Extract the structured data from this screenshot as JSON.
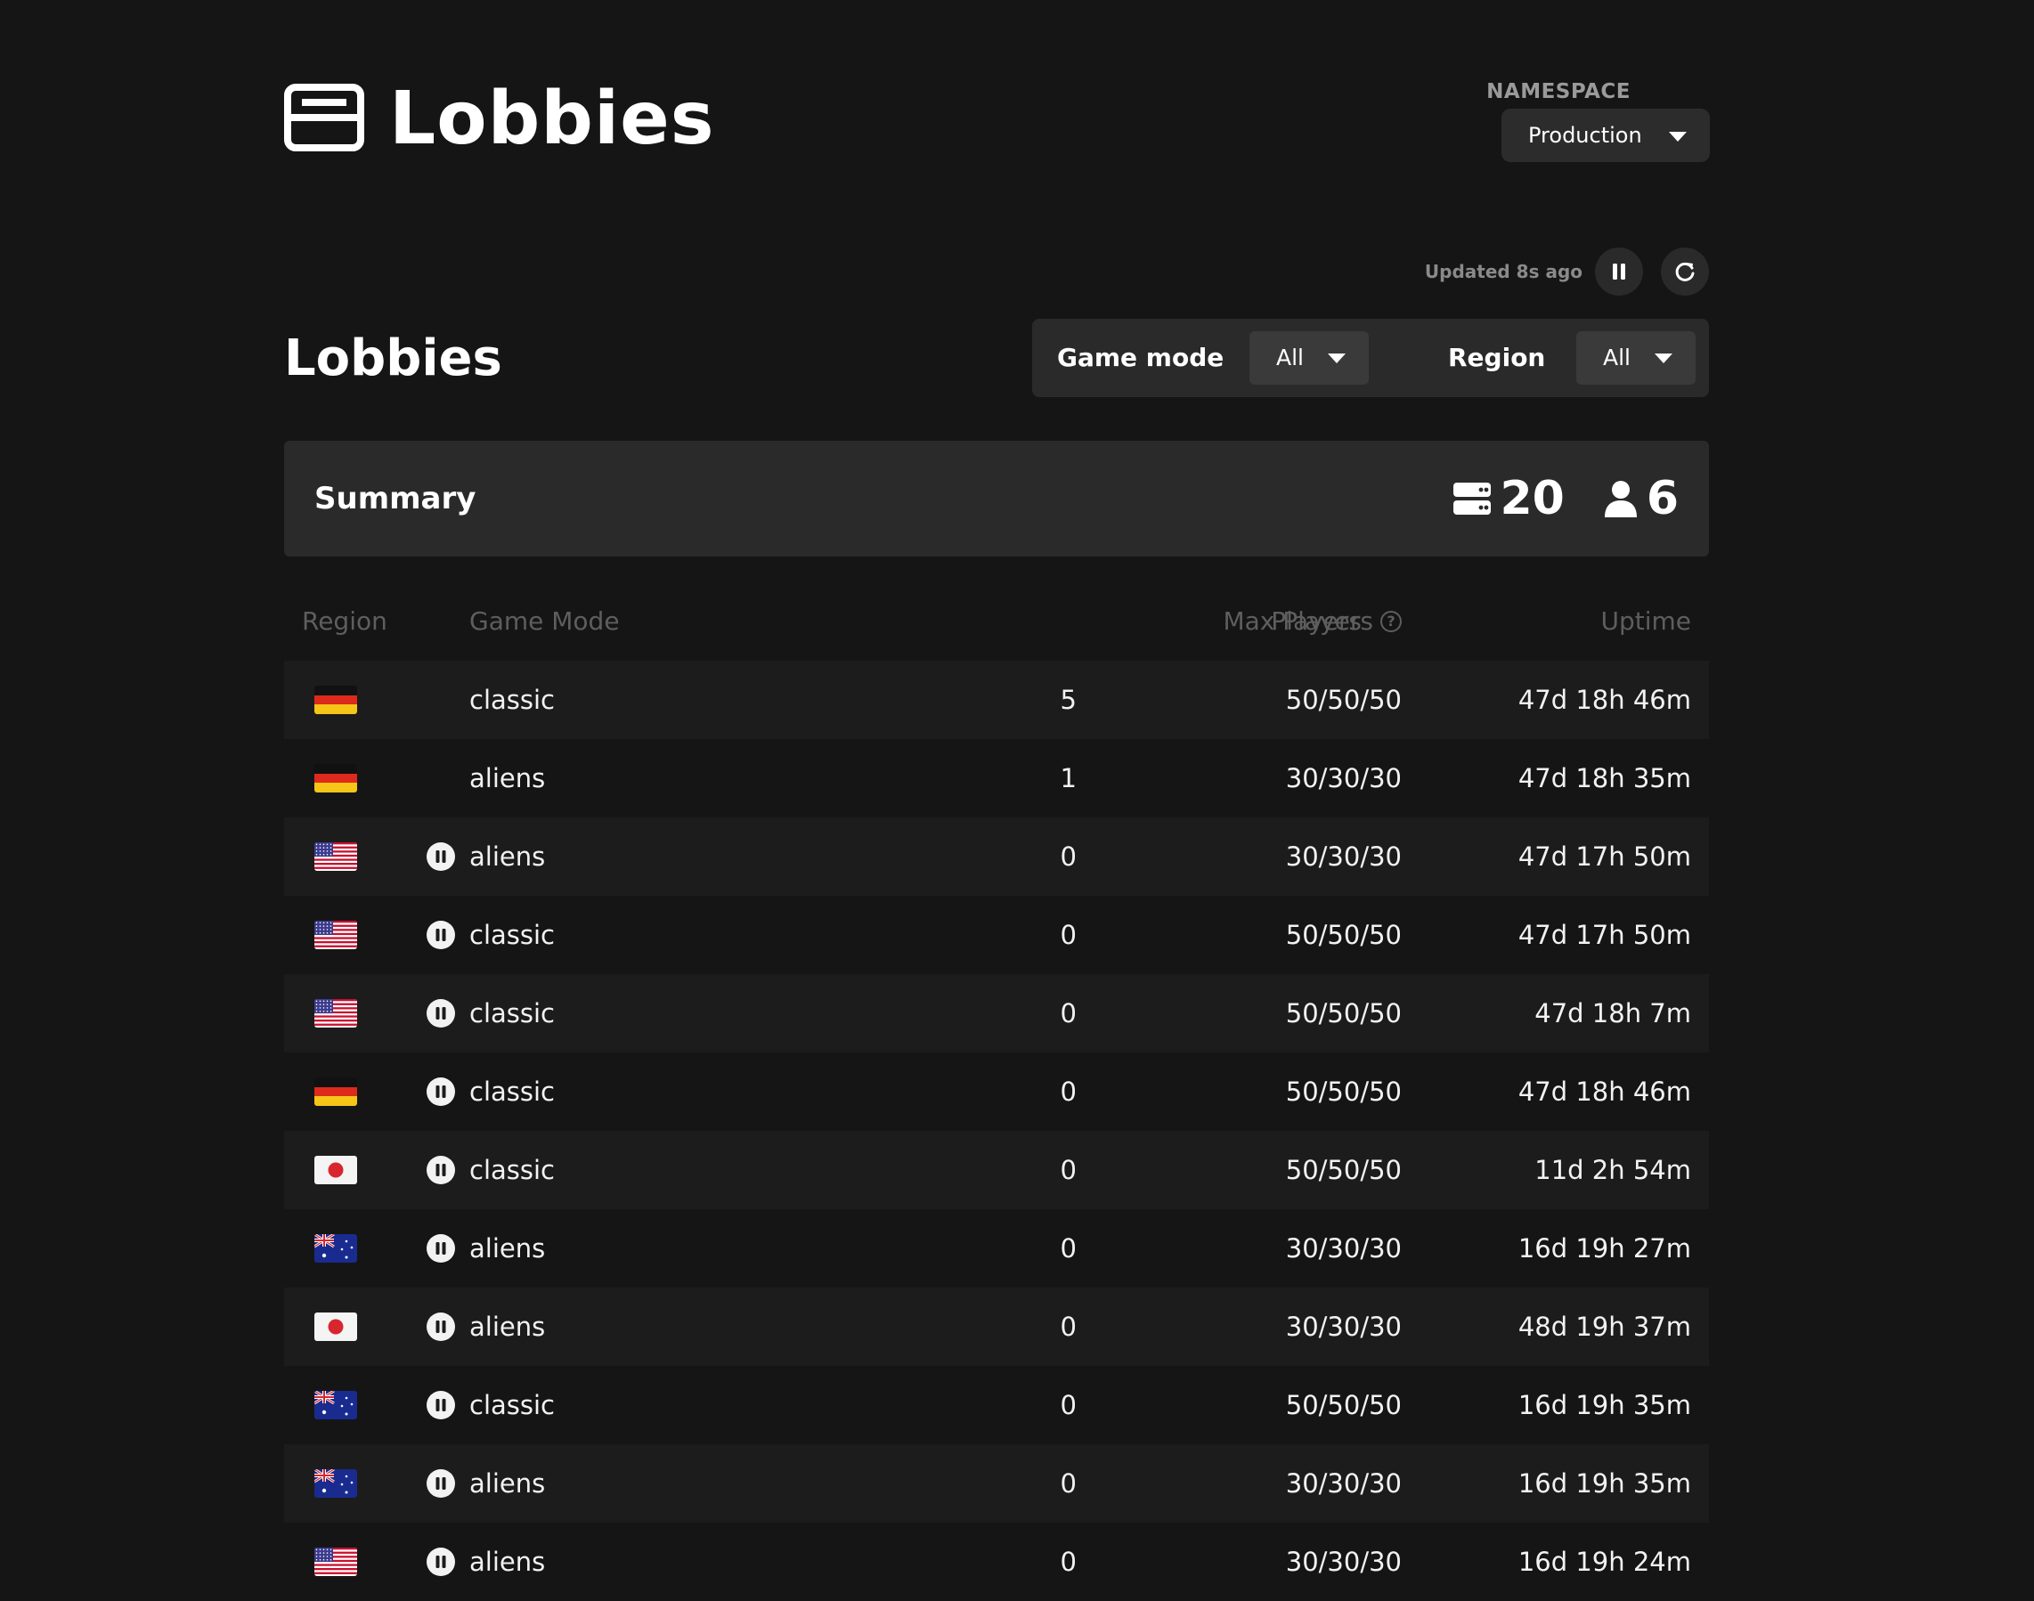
{
  "header": {
    "title": "Lobbies",
    "namespace_label": "NAMESPACE",
    "namespace_value": "Production"
  },
  "refresh": {
    "updated_text": "Updated 8s ago"
  },
  "section": {
    "title": "Lobbies"
  },
  "filters": {
    "game_mode_label": "Game mode",
    "game_mode_value": "All",
    "region_label": "Region",
    "region_value": "All"
  },
  "summary": {
    "title": "Summary",
    "lobby_count": "20",
    "player_count": "6"
  },
  "table": {
    "headers": {
      "region": "Region",
      "game_mode": "Game Mode",
      "players": "Players",
      "max_players": "Max Players",
      "help": "?",
      "uptime": "Uptime"
    },
    "rows": [
      {
        "flag": "germany",
        "paused": false,
        "mode": "classic",
        "players": "5",
        "max": "50/50/50",
        "uptime": "47d 18h 46m"
      },
      {
        "flag": "germany",
        "paused": false,
        "mode": "aliens",
        "players": "1",
        "max": "30/30/30",
        "uptime": "47d 18h 35m"
      },
      {
        "flag": "usa",
        "paused": true,
        "mode": "aliens",
        "players": "0",
        "max": "30/30/30",
        "uptime": "47d 17h 50m"
      },
      {
        "flag": "usa",
        "paused": true,
        "mode": "classic",
        "players": "0",
        "max": "50/50/50",
        "uptime": "47d 17h 50m"
      },
      {
        "flag": "usa",
        "paused": true,
        "mode": "classic",
        "players": "0",
        "max": "50/50/50",
        "uptime": "47d 18h 7m"
      },
      {
        "flag": "germany",
        "paused": true,
        "mode": "classic",
        "players": "0",
        "max": "50/50/50",
        "uptime": "47d 18h 46m"
      },
      {
        "flag": "japan",
        "paused": true,
        "mode": "classic",
        "players": "0",
        "max": "50/50/50",
        "uptime": "11d 2h 54m"
      },
      {
        "flag": "australia",
        "paused": true,
        "mode": "aliens",
        "players": "0",
        "max": "30/30/30",
        "uptime": "16d 19h 27m"
      },
      {
        "flag": "japan",
        "paused": true,
        "mode": "aliens",
        "players": "0",
        "max": "30/30/30",
        "uptime": "48d 19h 37m"
      },
      {
        "flag": "australia",
        "paused": true,
        "mode": "classic",
        "players": "0",
        "max": "50/50/50",
        "uptime": "16d 19h 35m"
      },
      {
        "flag": "australia",
        "paused": true,
        "mode": "aliens",
        "players": "0",
        "max": "30/30/30",
        "uptime": "16d 19h 35m"
      },
      {
        "flag": "usa",
        "paused": true,
        "mode": "aliens",
        "players": "0",
        "max": "30/30/30",
        "uptime": "16d 19h 24m"
      }
    ]
  },
  "icons": {
    "title": "lobbies-icon",
    "pause": "pause-icon",
    "refresh": "refresh-icon",
    "servers": "server-icon",
    "players": "user-icon",
    "help": "help-circle-icon"
  },
  "colors": {
    "background": "#151515",
    "surface": "#2a2a2a",
    "row_stripe": "#1c1c1c",
    "muted_text": "#5e5e5e"
  }
}
